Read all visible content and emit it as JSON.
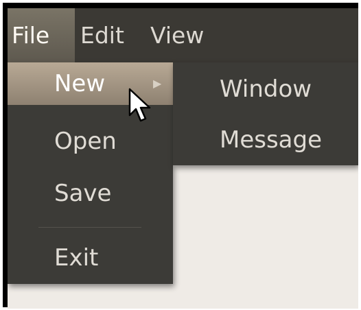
{
  "menubar": {
    "items": [
      {
        "label": "File",
        "active": true
      },
      {
        "label": "Edit",
        "active": false
      },
      {
        "label": "View",
        "active": false
      }
    ]
  },
  "file_menu": {
    "items": [
      {
        "label": "New",
        "highlighted": true,
        "has_submenu": true
      },
      {
        "label": "Open"
      },
      {
        "label": "Save"
      },
      {
        "label": "Exit"
      }
    ],
    "submenu_arrow_icon": "triangle-right"
  },
  "new_submenu": {
    "items": [
      {
        "label": "Window"
      },
      {
        "label": "Message"
      }
    ]
  },
  "colors": {
    "menu_background": "#3c3b37",
    "highlight": "#a89a86",
    "window_background": "#efebe6",
    "text": "#e0dcd5"
  }
}
